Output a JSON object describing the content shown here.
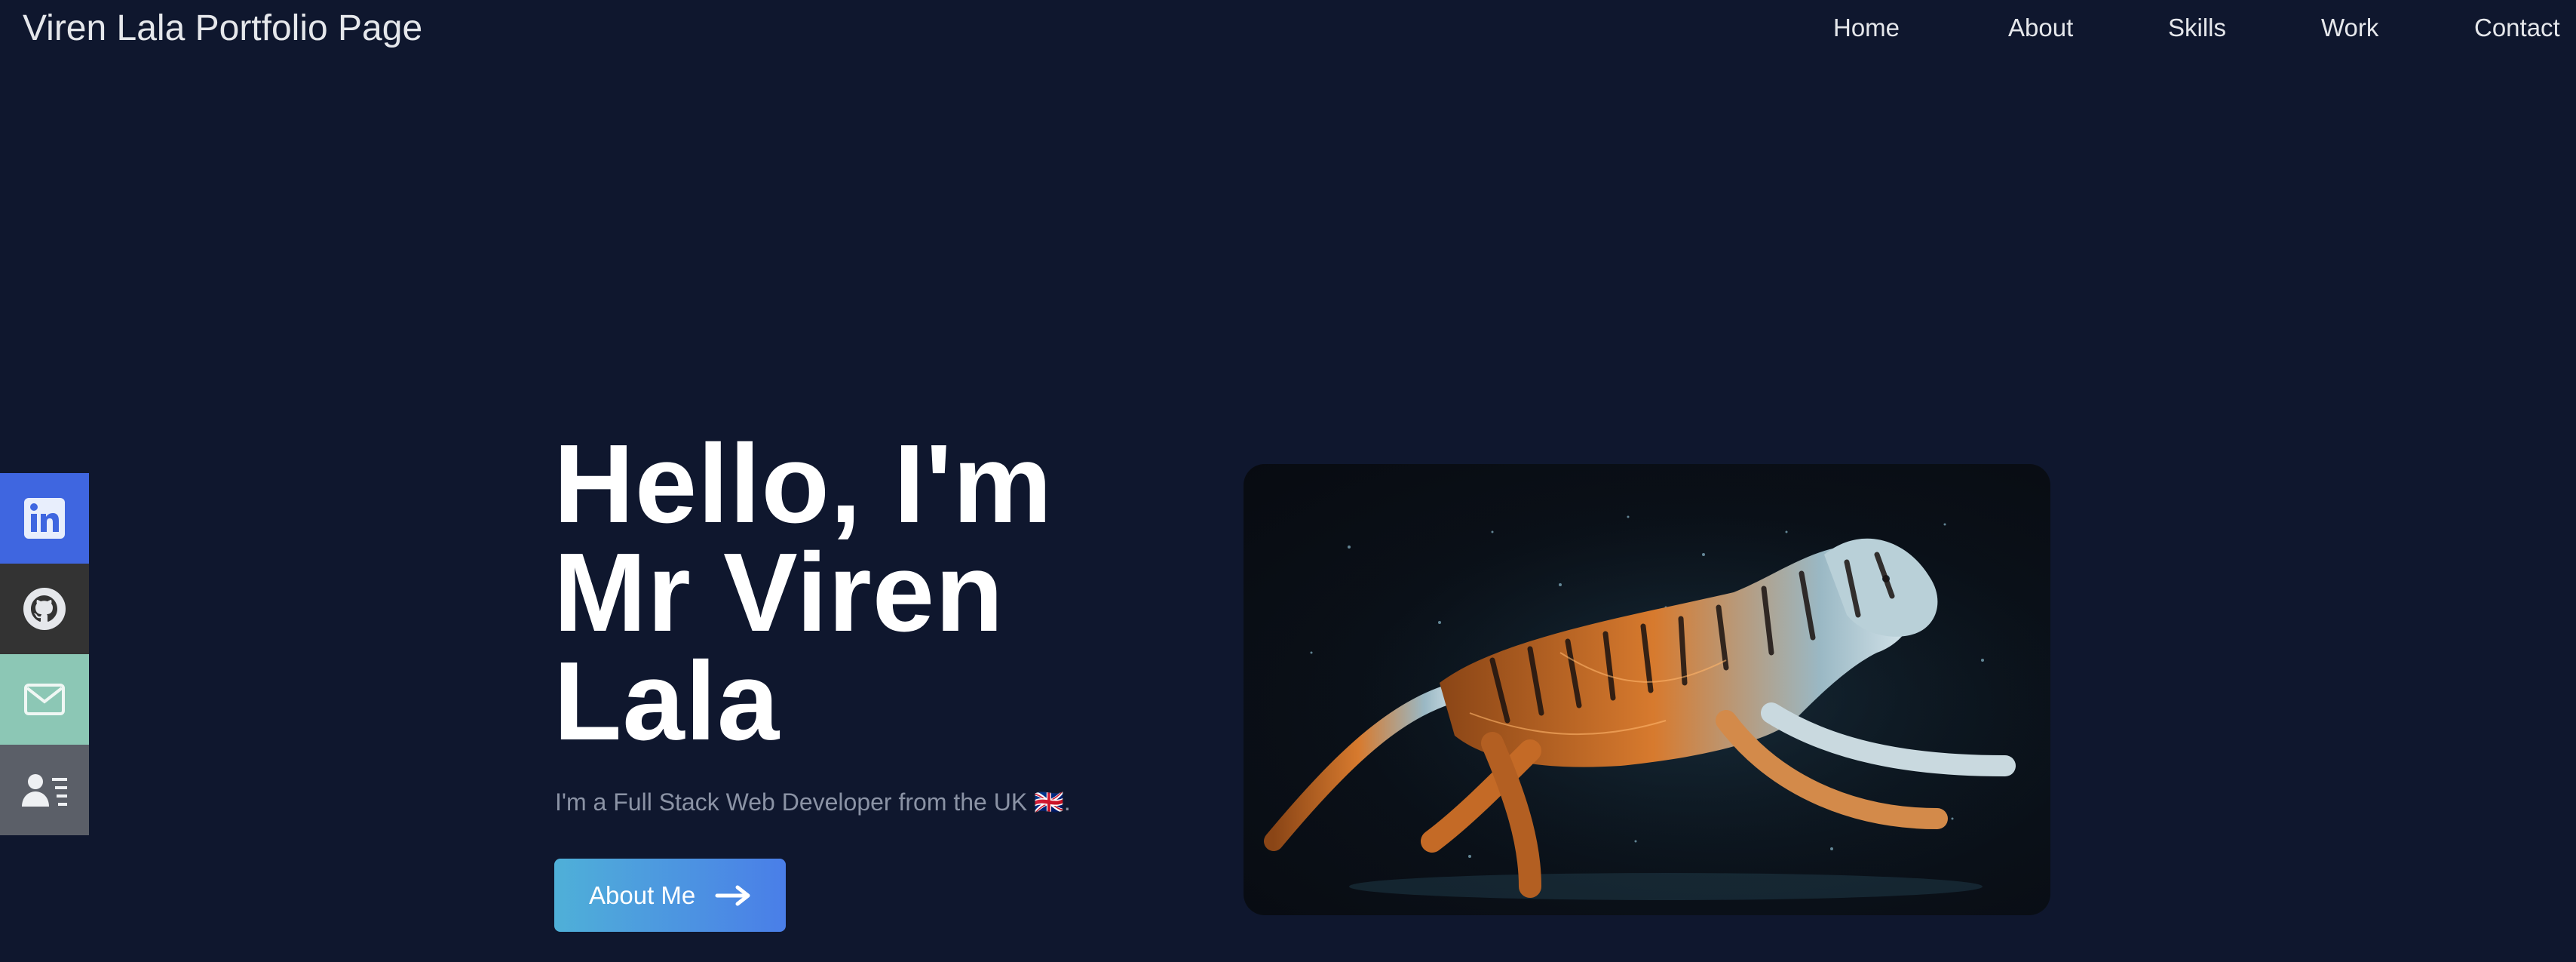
{
  "brand": {
    "title": "Viren Lala Portfolio Page"
  },
  "nav": {
    "items": [
      {
        "label": "Home"
      },
      {
        "label": "About"
      },
      {
        "label": "Skills"
      },
      {
        "label": "Work"
      },
      {
        "label": "Contact"
      }
    ]
  },
  "social": {
    "items": [
      {
        "icon": "linkedin-icon",
        "color": "#3f66e0"
      },
      {
        "icon": "github-icon",
        "color": "#333333"
      },
      {
        "icon": "mail-icon",
        "color": "#8cc7b5"
      },
      {
        "icon": "contact-card-icon",
        "color": "#5b5f68"
      }
    ]
  },
  "hero": {
    "title": "Hello, I'm Mr Viren Lala",
    "subtitle": "I'm a Full Stack Web Developer from the UK 🇬🇧.",
    "button_label": "About Me",
    "button_icon": "arrow-right-icon",
    "image_subject": "tiger-image"
  },
  "colors": {
    "background": "#0f172e",
    "button_gradient_start": "#4fb0d8",
    "button_gradient_end": "#4a7ee8"
  }
}
